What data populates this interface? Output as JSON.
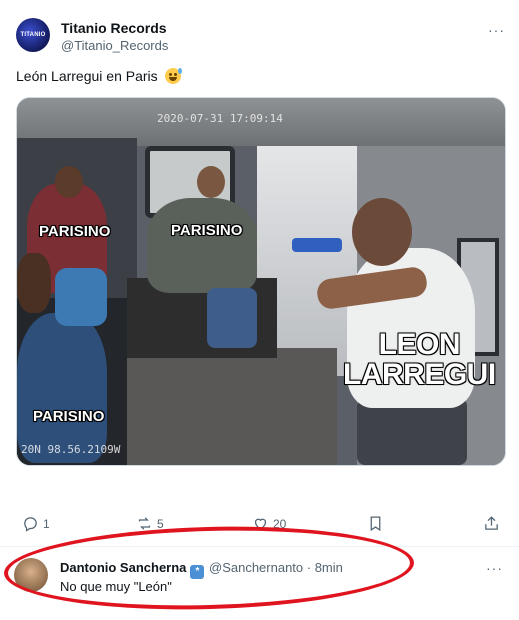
{
  "post": {
    "author_name": "Titanio Records",
    "author_handle": "@Titanio_Records",
    "avatar_text": "TITANIO",
    "text": "León Larregui en Paris",
    "emoji": "grinning-face-with-sweat-emoji",
    "more_label": "···"
  },
  "media": {
    "timestamp_top": "2020-07-31  17:09:14",
    "timestamp_bottom": "20N 98.56.2109W",
    "labels": [
      "PARISINO",
      "PARISINO",
      "PARISINO",
      "LEON",
      "LARREGUI"
    ]
  },
  "actions": {
    "reply_count": "1",
    "repost_count": "5",
    "like_count": "20",
    "bookmark_label": "",
    "share_label": ""
  },
  "reply": {
    "author_name": "Dantonio Sancherna",
    "badge": "*",
    "handle_time": "@Sanchernanto · 8min",
    "text": "No que muy \"León\"",
    "more_label": "···"
  },
  "colors": {
    "annotation_circle": "#e0141e",
    "muted_text": "#536471",
    "badge": "#4b8fd4"
  }
}
